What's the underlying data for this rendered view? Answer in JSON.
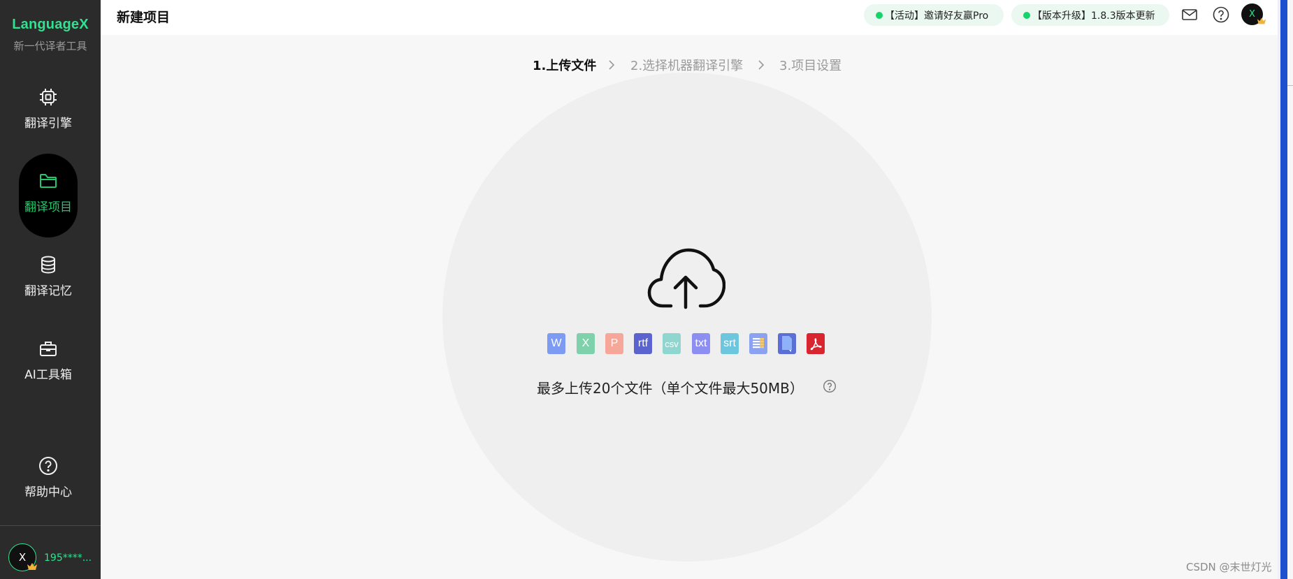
{
  "sidebar": {
    "logo": "LanguageX",
    "subtitle": "新一代译者工具",
    "items": [
      {
        "label": "翻译引擎",
        "icon": "chip-icon"
      },
      {
        "label": "翻译项目",
        "icon": "folder-icon",
        "active": true
      },
      {
        "label": "翻译记忆",
        "icon": "database-icon"
      },
      {
        "label": "AI工具箱",
        "icon": "toolbox-icon"
      },
      {
        "label": "帮助中心",
        "icon": "help-circle-icon"
      }
    ],
    "user": {
      "avatar_letter": "X",
      "name": "195****..."
    }
  },
  "header": {
    "title": "新建项目",
    "promo_pill": "【活动】邀请好友赢Pro",
    "upgrade_pill": "【版本升级】1.8.3版本更新",
    "icons": [
      "mail-icon",
      "help-icon"
    ],
    "avatar_letter": "X"
  },
  "stepper": {
    "steps": [
      "1.上传文件",
      "2.选择机器翻译引擎",
      "3.项目设置"
    ],
    "active_index": 0
  },
  "upload": {
    "icon": "cloud-upload-icon",
    "file_types": [
      {
        "label": "W",
        "name": "word",
        "color": "#7d9bf3"
      },
      {
        "label": "X",
        "name": "excel",
        "color": "#7fd1ac"
      },
      {
        "label": "P",
        "name": "powerpoint",
        "color": "#f6a79a"
      },
      {
        "label": "rtf",
        "name": "rtf",
        "color": "#5b63cf"
      },
      {
        "label": "csv",
        "name": "csv",
        "color": "#8fd6d0"
      },
      {
        "label": "txt",
        "name": "txt",
        "color": "#8d8ef2"
      },
      {
        "label": "srt",
        "name": "srt",
        "color": "#6cc7de"
      },
      {
        "label": "",
        "name": "table",
        "color": "#8aa2f0"
      },
      {
        "label": "",
        "name": "book",
        "color": "#5b6fd6"
      },
      {
        "label": "",
        "name": "pdf",
        "color": "#d9252f"
      }
    ],
    "hint": "最多上传20个文件（单个文件最大50MB）"
  },
  "watermark": "CSDN @末世灯光",
  "colors": {
    "accent": "#2ee38f",
    "sidebar_bg": "#2b2b2b",
    "active_text": "#22c86e"
  }
}
